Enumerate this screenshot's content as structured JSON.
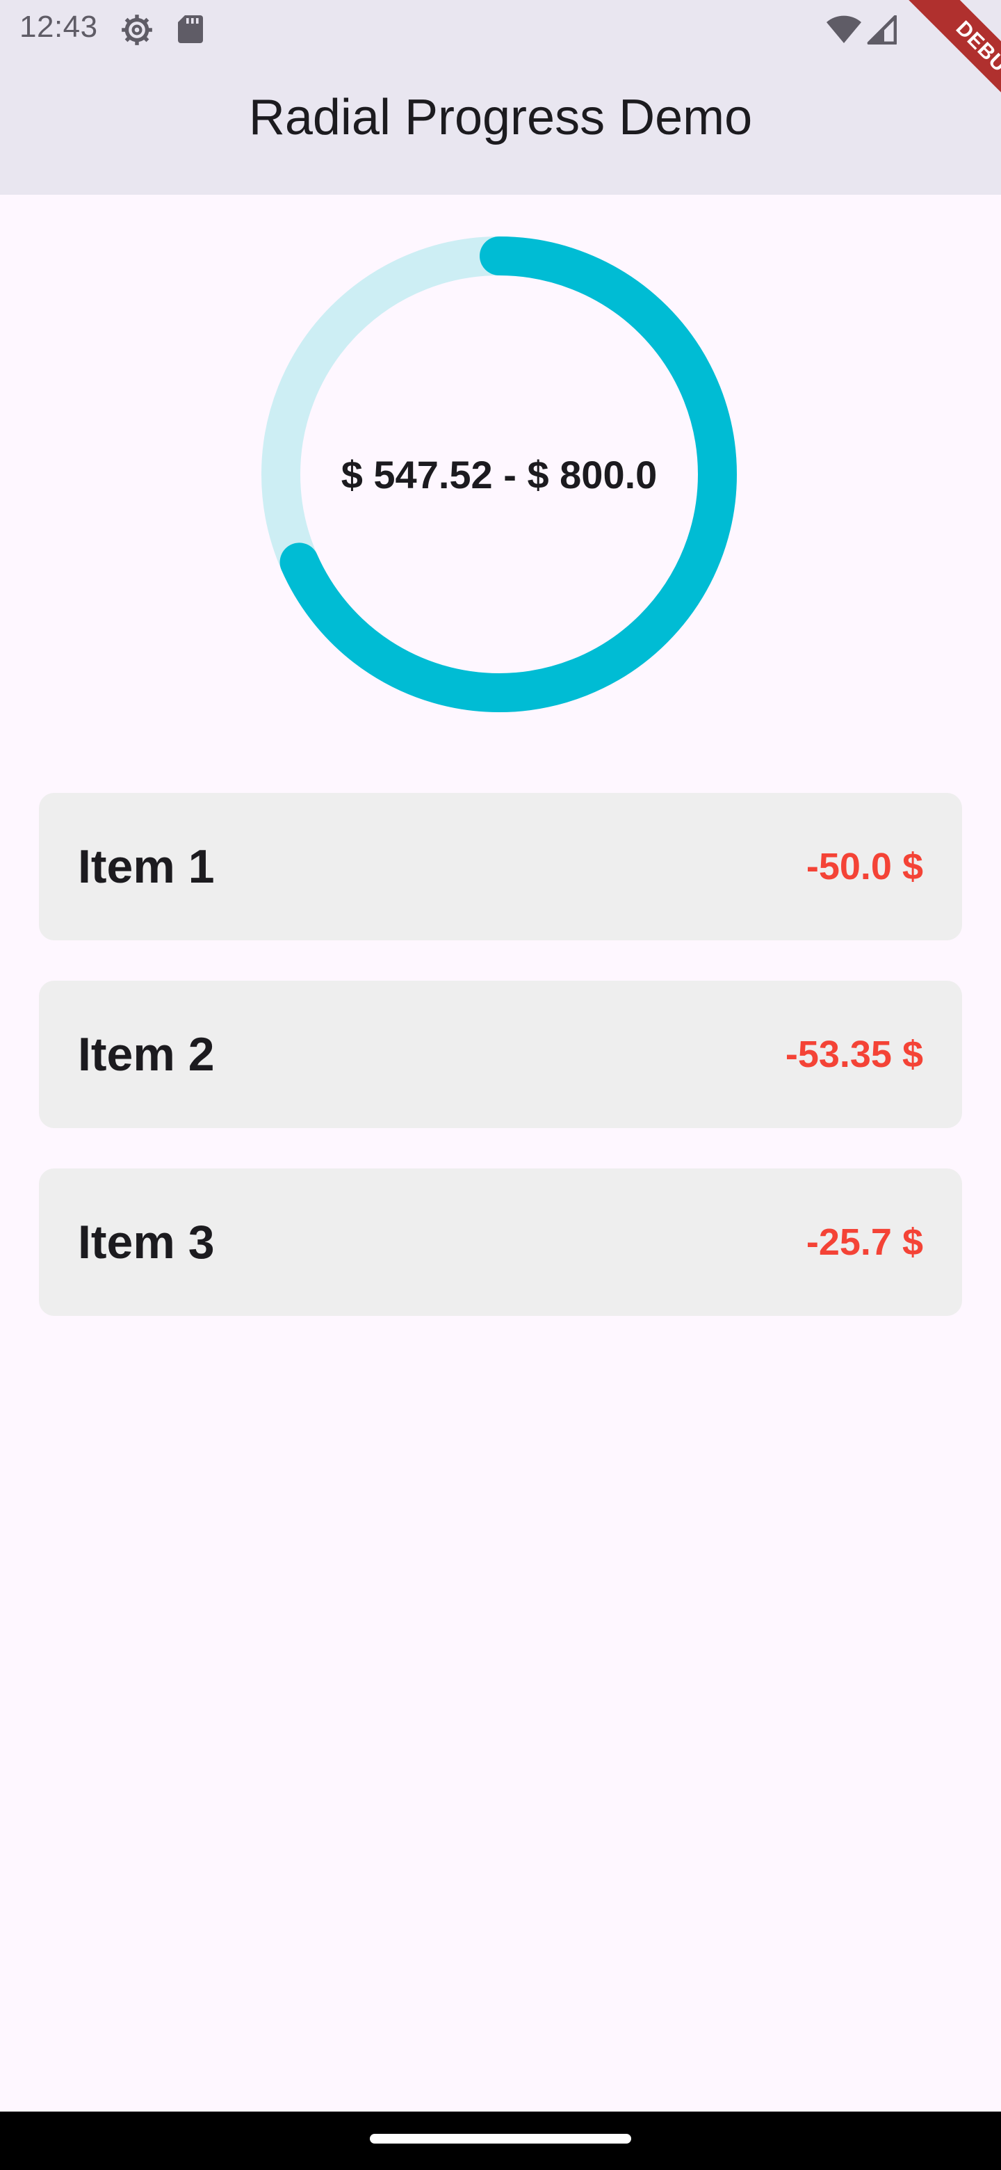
{
  "status_bar": {
    "time": "12:43",
    "icons": [
      "settings-gear-icon",
      "sd-card-icon",
      "wifi-icon",
      "cell-signal-icon"
    ]
  },
  "app_bar": {
    "title": "Radial Progress Demo"
  },
  "debug_banner": {
    "label": "DEBUG",
    "color": "#B0302E"
  },
  "radial_progress": {
    "label": "$ 547.52 - $ 800.0",
    "current": 547.52,
    "total": 800.0,
    "progress_fraction": 0.684,
    "track_color": "#CDEEF4",
    "progress_color": "#00BCD4"
  },
  "items": [
    {
      "name": "Item 1",
      "amount": "-50.0 $"
    },
    {
      "name": "Item 2",
      "amount": "-53.35 $"
    },
    {
      "name": "Item 3",
      "amount": "-25.7 $"
    }
  ],
  "colors": {
    "negative_amount": "#F44336",
    "item_background": "#EEEEEE",
    "app_bar_background": "#E9E6F0",
    "page_background": "#FEF7FF"
  }
}
